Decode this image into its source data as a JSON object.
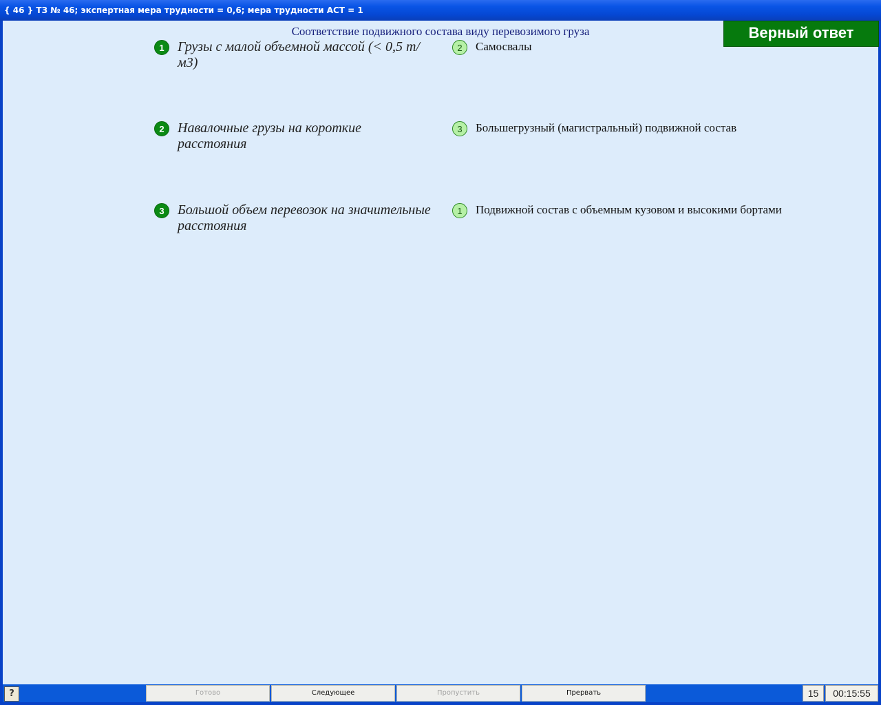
{
  "window": {
    "title": "{ 46 } ТЗ № 46; экспертная мера трудности = 0,6; мера трудности АСТ = 1"
  },
  "question": {
    "title": "Соответствие подвижного состава виду перевозимого груза"
  },
  "result": {
    "label": "Верный ответ"
  },
  "left_items": [
    {
      "number": "1",
      "text": "Грузы с малой объемной массой (< 0,5 т/м3)"
    },
    {
      "number": "2",
      "text": "Навалочные грузы на короткие расстояния"
    },
    {
      "number": "3",
      "text": "Большой объем перевозок на значительные расстояния"
    }
  ],
  "right_items": [
    {
      "number": "2",
      "text": "Самосвалы"
    },
    {
      "number": "3",
      "text": "Большегрузный (магистральный) подвижной состав"
    },
    {
      "number": "1",
      "text": "Подвижной состав с объемным кузовом и высокими бортами"
    }
  ],
  "taskbar": {
    "help_icon": "?",
    "ready_label": "Готово",
    "next_label": "Следующее",
    "skip_label": "Пропустить",
    "abort_label": "Прервать",
    "counter": "15",
    "timer": "00:15:55"
  },
  "colors": {
    "background": "#ddecfb",
    "accent_green": "#067a0d",
    "title_blue": "#0548d4"
  }
}
